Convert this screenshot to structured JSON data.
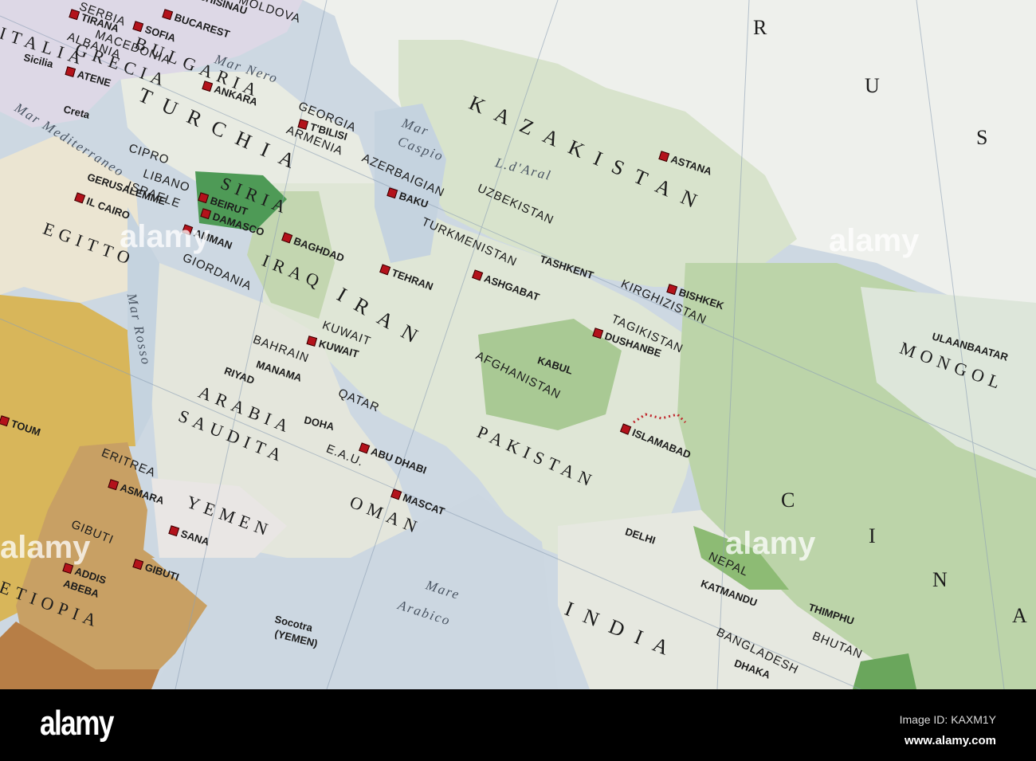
{
  "countries": {
    "rus1": "R",
    "rus2": "U",
    "rus3": "S",
    "kazakistan": "KAZAKISTAN",
    "turchia": "TURCHIA",
    "siria": "SIRIA",
    "egitto": "EGITTO",
    "iraq": "IRAQ",
    "iran": "IRAN",
    "arabia": "ARABIA",
    "saudita": "SAUDITA",
    "yemen": "YEMEN",
    "oman": "OMAN",
    "pakistan": "PAKISTAN",
    "afghanistan": "AFGHANISTAN",
    "uzbekistan": "UZBEKISTAN",
    "turkmenistan": "TURKMENISTAN",
    "kirghizistan": "KIRGHIZISTAN",
    "tagikistan": "TAGIKISTAN",
    "mongolia": "MONGOL",
    "cina_c": "C",
    "cina_i": "I",
    "cina_n": "N",
    "cina_a": "A",
    "india": "INDIA",
    "nepal": "NEPAL",
    "bhutan": "BHUTAN",
    "bangladesh": "BANGLADESH",
    "eritrea": "ERITREA",
    "gibuti": "GIBUTI",
    "etiopia": "ETIOPIA",
    "italia": "ITALIA",
    "grecia": "GRECIA",
    "albania": "ALBANIA",
    "macedonia": "MACEDONIA",
    "bulgaria": "BULGARIA",
    "georgia": "GEORGIA",
    "armenia": "ARMENIA",
    "azerbaigian": "AZERBAIGIAN",
    "libano": "LIBANO",
    "israele": "ISRAELE",
    "giordania": "GIORDANIA",
    "kuwait": "KUWAIT",
    "bahrain": "BAHRAIN",
    "qatar": "QATAR",
    "eau": "E.A.U.",
    "cipro": "CIPRO",
    "moldova": "MOLDOVA",
    "serbia": "SERBIA"
  },
  "cities": {
    "bucarest": "BUCAREST",
    "sofia": "SOFIA",
    "tirana": "TIRANA",
    "atene": "ATENE",
    "ankara": "ANKARA",
    "tbilisi": "T'BILISI",
    "baku": "BAKU",
    "beirut": "BEIRUT",
    "damasco": "DAMASCO",
    "gerusalemme": "GERUSALEMME",
    "cairo": "IL CAIRO",
    "amman": "AMMAN",
    "baghdad": "BAGHDAD",
    "tehran": "TEHRAN",
    "ashgabat": "ASHGABAT",
    "tashkent": "TASHKENT",
    "bishkek": "BISHKEK",
    "dushanbe": "DUSHANBE",
    "astana": "ASTANA",
    "kabul": "KABUL",
    "islamabad": "ISLAMABAD",
    "kuwait": "KUWAIT",
    "manama": "MANAMA",
    "riyad": "RIYAD",
    "doha": "DOHA",
    "abudhabi": "ABU DHABI",
    "mascat": "MASCAT",
    "sana": "SANA",
    "asmara": "ASMARA",
    "gibuti": "GIBUTI",
    "addis": "ADDIS",
    "abeba": "ABEBA",
    "khartoum": "TOUM",
    "delhi": "DELHI",
    "katmandu": "KATMANDU",
    "thimphu": "THIMPHU",
    "dhaka": "DHAKA",
    "ulaanbaatar": "ULAANBAATAR",
    "chisinau": "CHISINAU",
    "sicilia": "Sicilia",
    "creta": "Creta",
    "socotra": "Socotra",
    "socotra_sub": "(YEMEN)"
  },
  "seas": {
    "nero": "Mar Nero",
    "mediterraneo": "Mar Mediterraneo",
    "mar_caspio": "Mar",
    "caspio": "Caspio",
    "aral": "L.d'Aral",
    "rosso": "Mar Rosso",
    "mare": "Mare",
    "arabico": "Arabico"
  },
  "watermark": {
    "logo": "alamy",
    "image_id": "Image ID: KAXM1Y",
    "site": "www.alamy.com"
  }
}
